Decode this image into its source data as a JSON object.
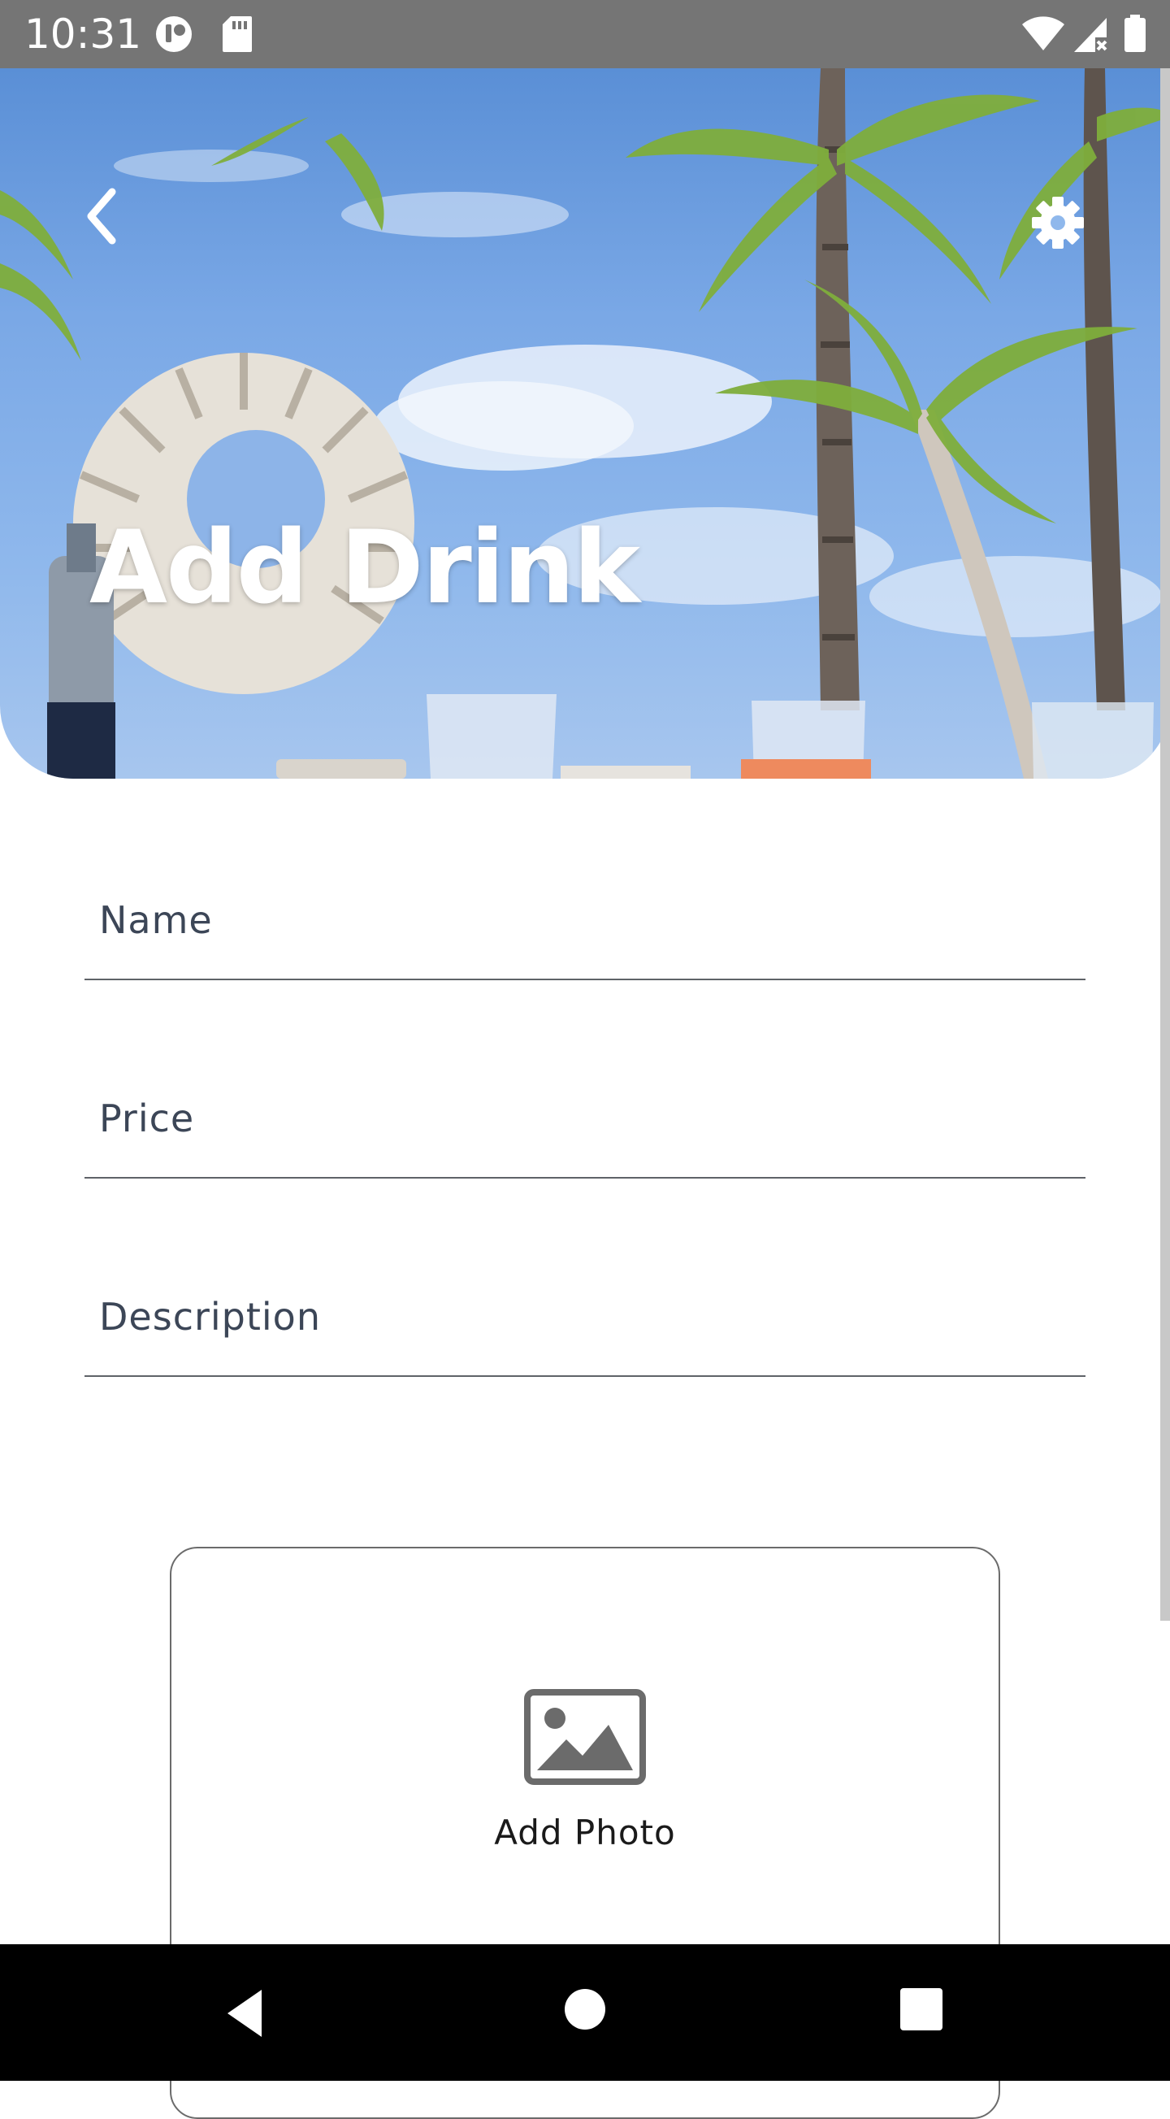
{
  "status_bar": {
    "time": "10:31",
    "icons": [
      "record-icon",
      "sd-card-icon",
      "wifi-icon",
      "signal-no-data-icon",
      "battery-icon"
    ]
  },
  "header": {
    "title": "Add Drink",
    "back_icon": "chevron-left-icon",
    "settings_icon": "gear-icon"
  },
  "form": {
    "name_placeholder": "Name",
    "name_value": "",
    "price_placeholder": "Price",
    "price_value": "",
    "description_placeholder": "Description",
    "description_value": ""
  },
  "photo": {
    "label": "Add Photo",
    "icon": "image-icon"
  },
  "nav_bar": {
    "icons": [
      "back-triangle-icon",
      "home-circle-icon",
      "recents-square-icon"
    ]
  },
  "colors": {
    "status_bar": "#757575",
    "field_text": "#3c4657",
    "nav_bar": "#000000"
  }
}
